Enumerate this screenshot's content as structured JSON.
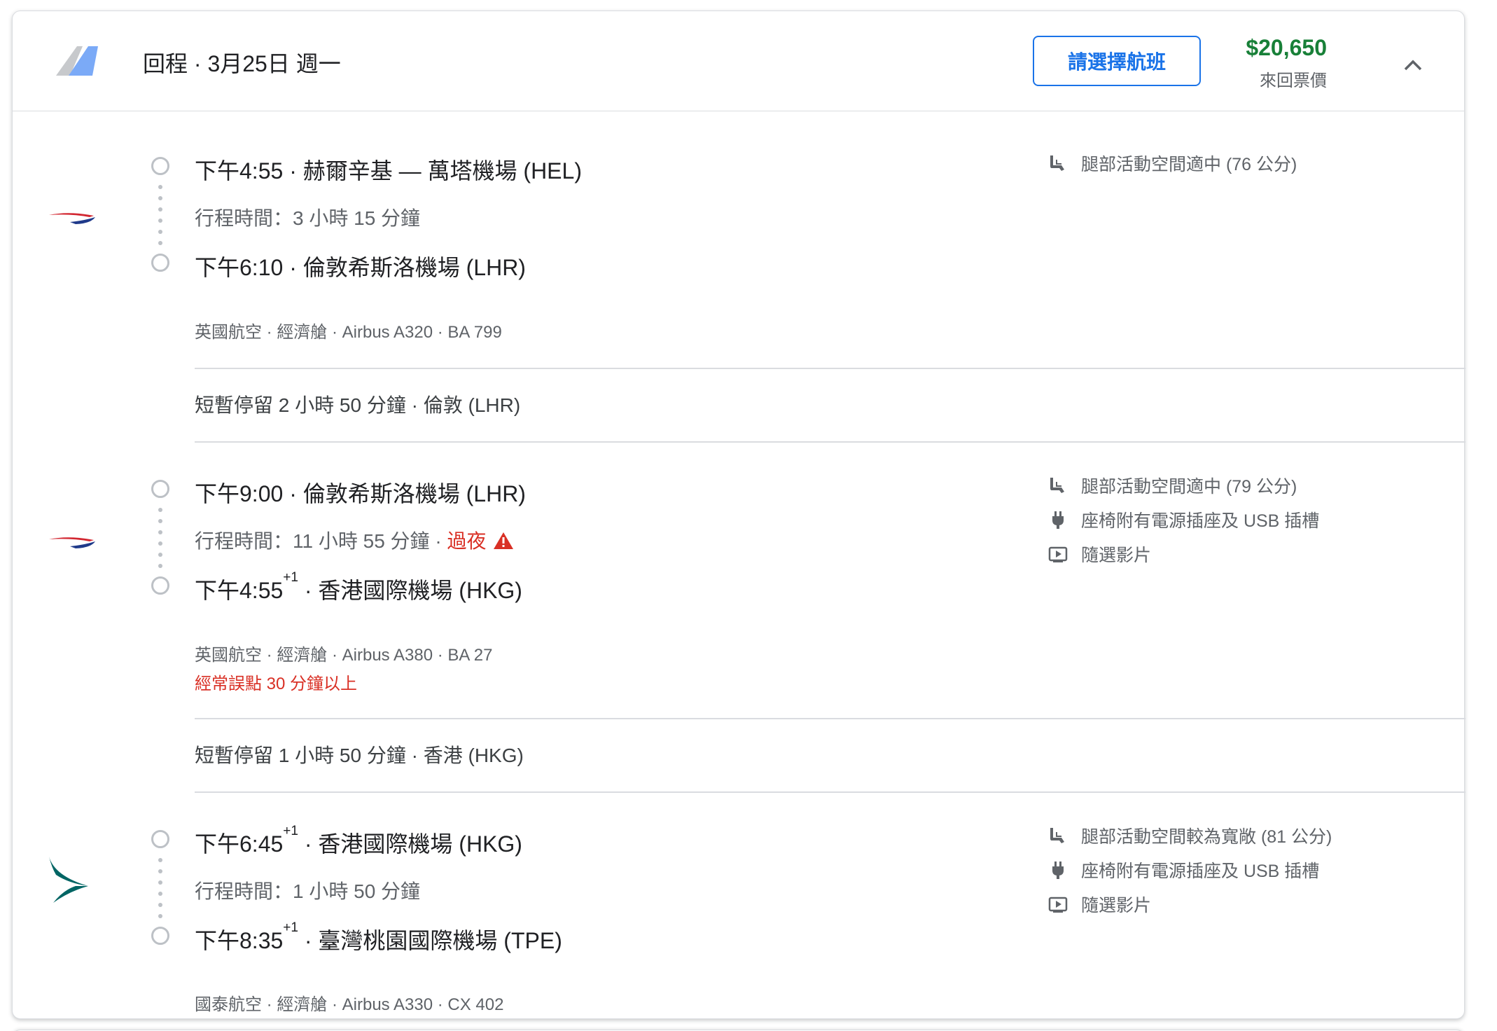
{
  "header": {
    "title": "回程 · 3月25日 週一",
    "select_button": "請選擇航班",
    "price": "$20,650",
    "price_label": "來回票價"
  },
  "segments": [
    {
      "airline_icon": "british-airways-logo",
      "depart": {
        "time": "下午4:55",
        "plus": "",
        "place": " · 赫爾辛基 — 萬塔機場 (HEL)"
      },
      "duration": "行程時間：3 小時 15 分鐘",
      "arrive": {
        "time": "下午6:10",
        "plus": "",
        "place": " · 倫敦希斯洛機場 (LHR)"
      },
      "info": "英國航空 · 經濟艙 · Airbus A320 · BA 799",
      "amenities": [
        {
          "icon": "legroom-icon",
          "text": "腿部活動空間適中 (76 公分)"
        }
      ]
    },
    {
      "airline_icon": "british-airways-logo",
      "depart": {
        "time": "下午9:00",
        "plus": "",
        "place": " · 倫敦希斯洛機場 (LHR)"
      },
      "duration": "行程時間：11 小時 55 分鐘 · ",
      "overnight": "過夜",
      "arrive": {
        "time": "下午4:55",
        "plus": "+1",
        "place": " · 香港國際機場 (HKG)"
      },
      "info": "英國航空 · 經濟艙 · Airbus A380 · BA 27",
      "delay": "經常誤點 30 分鐘以上",
      "amenities": [
        {
          "icon": "legroom-icon",
          "text": "腿部活動空間適中 (79 公分)"
        },
        {
          "icon": "power-plug-icon",
          "text": "座椅附有電源插座及 USB 插槽"
        },
        {
          "icon": "video-icon",
          "text": "隨選影片"
        }
      ]
    },
    {
      "airline_icon": "cathay-pacific-logo",
      "depart": {
        "time": "下午6:45",
        "plus": "+1",
        "place": " · 香港國際機場 (HKG)"
      },
      "duration": "行程時間：1 小時 50 分鐘",
      "arrive": {
        "time": "下午8:35",
        "plus": "+1",
        "place": " · 臺灣桃園國際機場 (TPE)"
      },
      "info": "國泰航空 · 經濟艙 · Airbus A330 · CX 402",
      "amenities": [
        {
          "icon": "legroom-icon",
          "text": "腿部活動空間較為寬敞 (81 公分)"
        },
        {
          "icon": "power-plug-icon",
          "text": "座椅附有電源插座及 USB 插槽"
        },
        {
          "icon": "video-icon",
          "text": "隨選影片"
        }
      ]
    }
  ],
  "layovers": [
    "短暫停留 2 小時 50 分鐘 · 倫敦 (LHR)",
    "短暫停留 1 小時 50 分鐘 · 香港 (HKG)"
  ],
  "colors": {
    "accent_blue": "#1a73e8",
    "price_green": "#188038",
    "warning_red": "#d93025"
  }
}
